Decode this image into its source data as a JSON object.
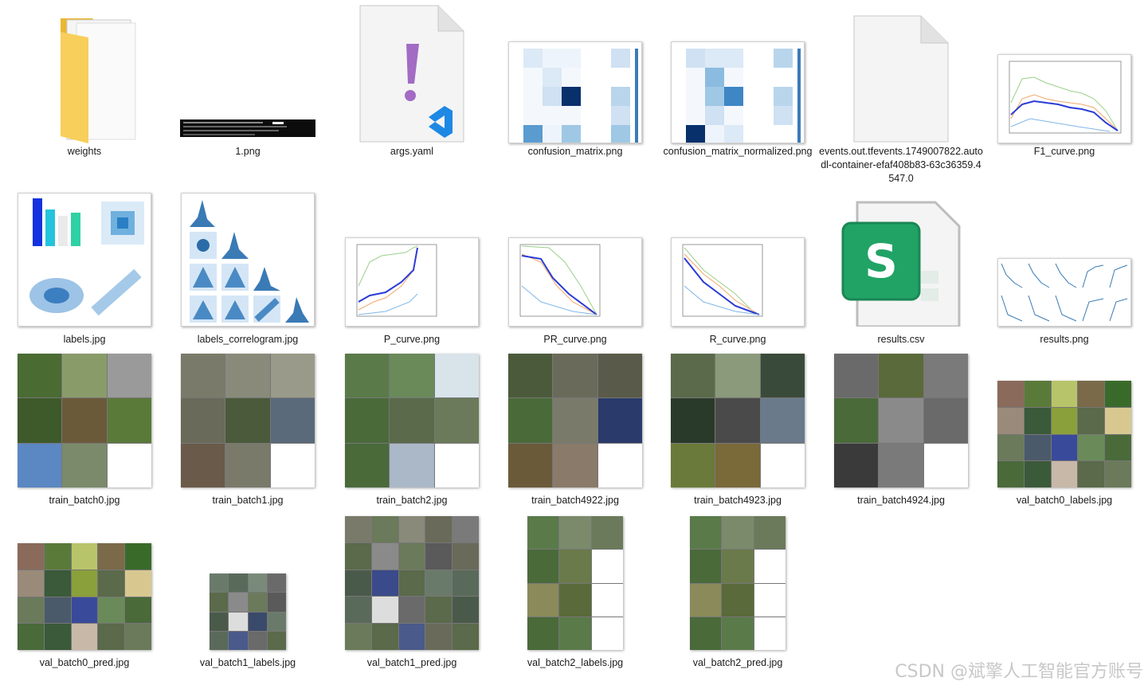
{
  "files": [
    {
      "name": "weights",
      "icon": "folder-icon"
    },
    {
      "name": "1.png",
      "icon": "terminal-image-icon"
    },
    {
      "name": "args.yaml",
      "icon": "yaml-file-icon"
    },
    {
      "name": "confusion_matrix.png",
      "icon": "heatmap-image-icon"
    },
    {
      "name": "confusion_matrix_normalized.png",
      "icon": "heatmap-image-icon"
    },
    {
      "name": "events.out.tfevents.1749007822.autodl-container-efaf408b83-63c36359.4547.0",
      "icon": "blank-file-icon"
    },
    {
      "name": "F1_curve.png",
      "icon": "curve-image-icon"
    },
    {
      "name": "labels.jpg",
      "icon": "labels-image-icon"
    },
    {
      "name": "labels_correlogram.jpg",
      "icon": "correlogram-image-icon"
    },
    {
      "name": "P_curve.png",
      "icon": "curve-image-icon"
    },
    {
      "name": "PR_curve.png",
      "icon": "curve-image-icon"
    },
    {
      "name": "R_curve.png",
      "icon": "curve-image-icon"
    },
    {
      "name": "results.csv",
      "icon": "spreadsheet-icon"
    },
    {
      "name": "results.png",
      "icon": "results-plots-icon"
    },
    {
      "name": "train_batch0.jpg",
      "icon": "photo-mosaic-icon"
    },
    {
      "name": "train_batch1.jpg",
      "icon": "photo-mosaic-icon"
    },
    {
      "name": "train_batch2.jpg",
      "icon": "photo-mosaic-icon"
    },
    {
      "name": "train_batch4922.jpg",
      "icon": "photo-mosaic-icon"
    },
    {
      "name": "train_batch4923.jpg",
      "icon": "photo-mosaic-icon"
    },
    {
      "name": "train_batch4924.jpg",
      "icon": "photo-mosaic-icon"
    },
    {
      "name": "val_batch0_labels.jpg",
      "icon": "photo-mosaic-icon"
    },
    {
      "name": "val_batch0_pred.jpg",
      "icon": "photo-mosaic-icon"
    },
    {
      "name": "val_batch1_labels.jpg",
      "icon": "photo-mosaic-icon"
    },
    {
      "name": "val_batch1_pred.jpg",
      "icon": "photo-mosaic-icon"
    },
    {
      "name": "val_batch2_labels.jpg",
      "icon": "photo-mosaic-icon"
    },
    {
      "name": "val_batch2_pred.jpg",
      "icon": "photo-mosaic-icon"
    }
  ],
  "watermark": "CSDN @斌擎人工智能官方账号",
  "colors": {
    "folder": "#f5c842",
    "yaml": "#a36bc4",
    "vscode": "#1e88e5",
    "sheet": "#21a366",
    "heat": "#08306b"
  }
}
